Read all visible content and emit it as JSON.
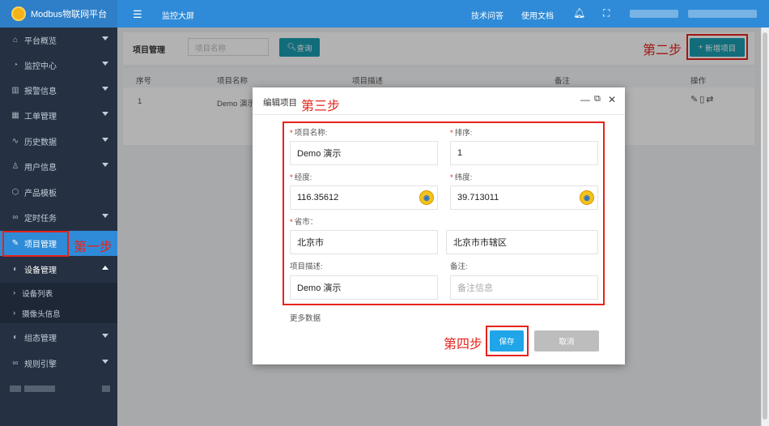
{
  "app": {
    "title": "Modbus物联网平台"
  },
  "topbar": {
    "monitor": "监控大屏",
    "tech_qa": "技术问答",
    "docs": "使用文档"
  },
  "sidebar": {
    "items": [
      {
        "label": "平台概览",
        "icon": "home-icon"
      },
      {
        "label": "监控中心",
        "icon": "dashboard-icon"
      },
      {
        "label": "报警信息",
        "icon": "alarm-icon"
      },
      {
        "label": "工单管理",
        "icon": "calendar-icon"
      },
      {
        "label": "历史数据",
        "icon": "pulse-icon"
      },
      {
        "label": "用户信息",
        "icon": "user-icon"
      },
      {
        "label": "产品模板",
        "icon": "cube-icon"
      },
      {
        "label": "定时任务",
        "icon": "infinity-icon"
      },
      {
        "label": "项目管理",
        "icon": "edit-icon"
      },
      {
        "label": "设备管理",
        "icon": "device-icon"
      },
      {
        "label": "组态管理",
        "icon": "device-icon"
      },
      {
        "label": "规则引擎",
        "icon": "infinity-icon"
      }
    ],
    "sub_items": [
      {
        "label": "设备列表"
      },
      {
        "label": "摄像头信息"
      }
    ]
  },
  "annotations": {
    "step1": "第一步",
    "step2": "第二步",
    "step3": "第三步",
    "step4": "第四步"
  },
  "toolbar": {
    "label": "项目管理",
    "search_placeholder": "项目名称",
    "search_button": "查询",
    "add_button": "新增项目"
  },
  "table": {
    "columns": [
      "序号",
      "项目名称",
      "项目描述",
      "备注",
      "操作"
    ],
    "rows": [
      {
        "index": "1",
        "name": "Demo 演示"
      }
    ]
  },
  "modal": {
    "title": "编辑项目",
    "fields": {
      "name_label": "项目名称:",
      "name_value": "Demo 演示",
      "sort_label": "排序:",
      "sort_value": "1",
      "lng_label": "经度:",
      "lng_value": "116.35612",
      "lat_label": "纬度:",
      "lat_value": "39.713011",
      "province_label": "省市：",
      "province_value": "北京市",
      "city_value": "北京市市辖区",
      "desc_label": "项目描述:",
      "desc_value": "Demo 演示",
      "remark_label": "备注:",
      "remark_placeholder": "备注信息"
    },
    "more": "更多数据",
    "save": "保存",
    "cancel": "取消"
  },
  "colors": {
    "topbar": "#2f8bd7",
    "sidebar": "#253142",
    "accent": "#1a9cb0",
    "annotation": "#e5231b"
  }
}
